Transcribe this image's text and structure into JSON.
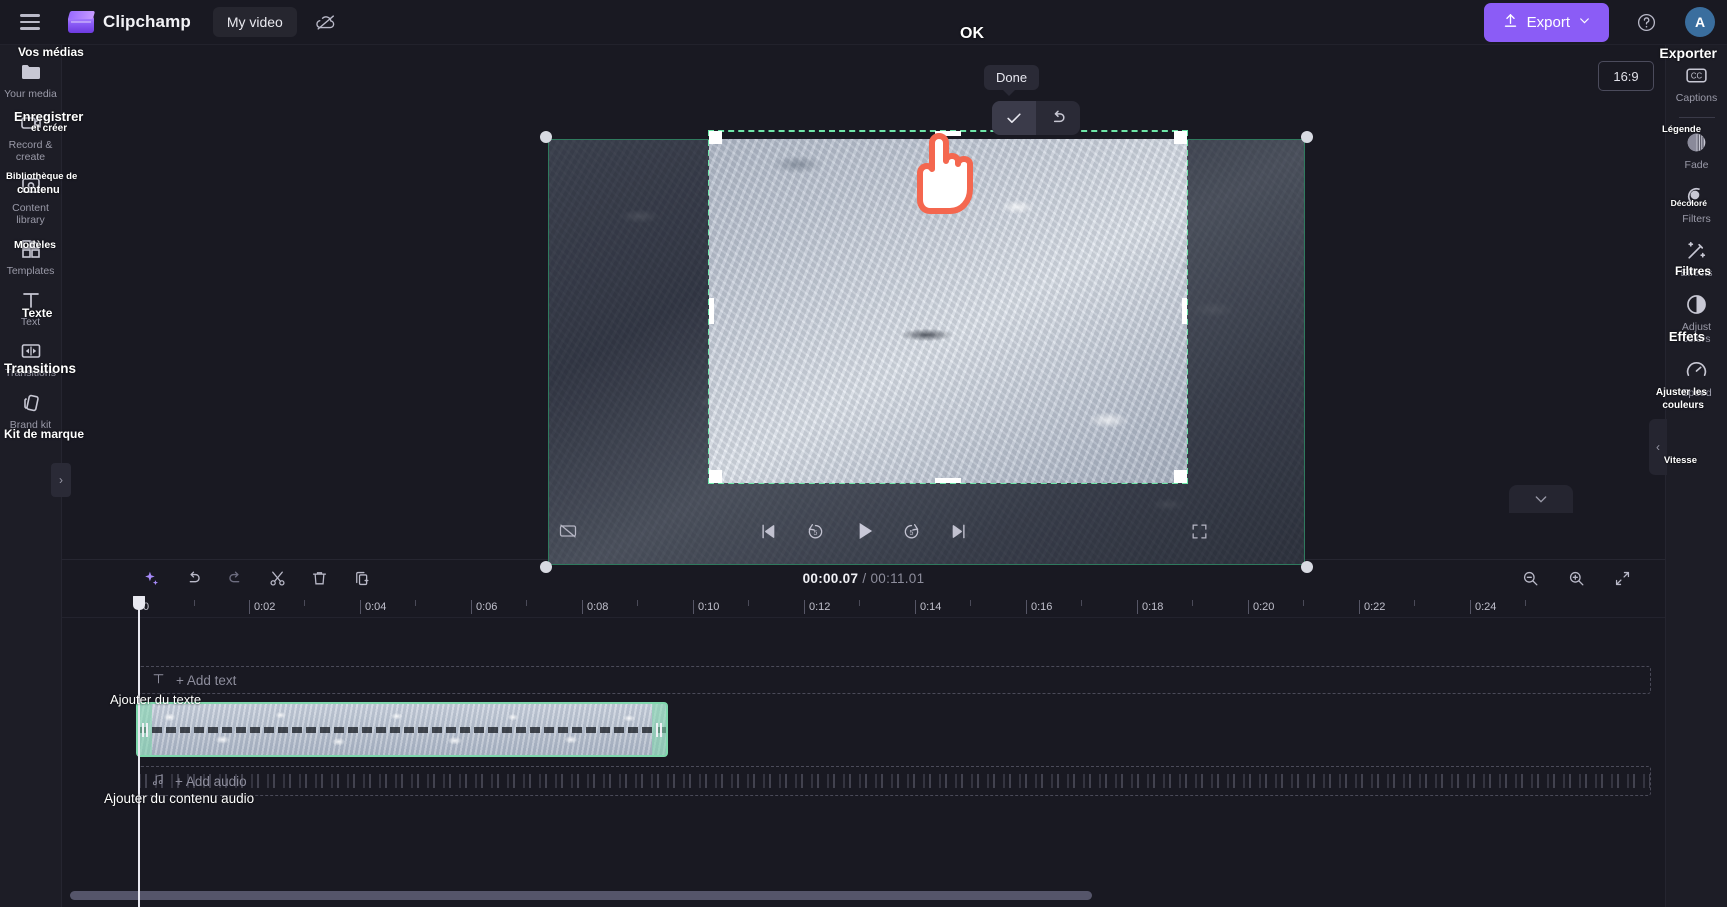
{
  "app": {
    "brand": "Clipchamp",
    "project_name": "My video",
    "avatar_initial": "A"
  },
  "topbar": {
    "menu_icon": "hamburger-icon",
    "logo_icon": "clipchamp-logo-icon",
    "cloud_off_icon": "cloud-off-icon",
    "export_label": "Export",
    "export_icon": "upload-icon",
    "export_chevron": "chevron-down-icon",
    "help_icon": "question-circle-icon",
    "export_color": "#8b5cf6"
  },
  "crop_toolbar": {
    "tooltip": "Done",
    "confirm_icon": "checkmark-icon",
    "reset_icon": "undo-arrow-icon"
  },
  "left_rail": {
    "items": [
      {
        "label": "Your media",
        "icon": "folder-icon",
        "fr": "Vos médias"
      },
      {
        "label": "Record & create",
        "icon": "record-icon",
        "fr": "Enregistrer et créer"
      },
      {
        "label": "Content library",
        "icon": "library-icon",
        "fr": "Bibliothèque de contenu"
      },
      {
        "label": "Templates",
        "icon": "templates-icon",
        "fr": "Modèles"
      },
      {
        "label": "Text",
        "icon": "text-t-icon",
        "fr": "Texte"
      },
      {
        "label": "Transitions",
        "icon": "transitions-icon",
        "fr": "Transitions"
      },
      {
        "label": "Brand kit",
        "icon": "brand-kit-icon",
        "fr": "Kit de marque"
      }
    ],
    "collapse_icon": "chevron-right-icon"
  },
  "right_rail": {
    "aspect_ratio": "16:9",
    "items": [
      {
        "label": "Captions",
        "icon": "cc-icon",
        "fr": ""
      },
      {
        "label": "Fade",
        "icon": "fade-circle-icon",
        "fr": "Légende"
      },
      {
        "label": "Filters",
        "icon": "filters-icon",
        "fr": "Décoloré"
      },
      {
        "label": "Effects",
        "icon": "effects-wand-icon",
        "fr": "Filtres"
      },
      {
        "label": "Adjust colors",
        "icon": "adjust-colors-icon",
        "fr": "Effets"
      },
      {
        "label": "Speed",
        "icon": "speed-icon",
        "fr": "Ajuster les couleurs"
      }
    ],
    "extra_fr": "Vitesse",
    "collapse_icon": "chevron-left-icon"
  },
  "overlay_fr": {
    "exporter": "Exporter",
    "ok": "OK",
    "add_text": "Ajouter du texte",
    "add_audio_content": "Ajouter du contenu audio"
  },
  "player": {
    "hand_cursor_icon": "pointing-hand-cursor",
    "selection_color": "#2f7a5e",
    "crop_border_color": "#6ee7a8"
  },
  "playback": {
    "mute_icon": "no-captions-icon",
    "skip_back_icon": "skip-previous-icon",
    "rewind_icon": "rewind-5-icon",
    "play_icon": "play-icon",
    "forward_icon": "forward-5-icon",
    "skip_forward_icon": "skip-next-icon",
    "fullscreen_icon": "fullscreen-icon",
    "collapse_icon": "chevron-down-icon"
  },
  "timeline": {
    "tools": [
      {
        "icon": "ai-sparkle-icon",
        "name": "magic-tools"
      },
      {
        "icon": "undo-icon",
        "name": "undo"
      },
      {
        "icon": "redo-icon",
        "name": "redo"
      },
      {
        "icon": "scissors-icon",
        "name": "split"
      },
      {
        "icon": "trash-icon",
        "name": "delete"
      },
      {
        "icon": "duplicate-icon",
        "name": "duplicate"
      }
    ],
    "current_time": "00:00.07",
    "total_time": "00:11.01",
    "time_separator": "/",
    "zoom_out_icon": "zoom-out-icon",
    "zoom_in_icon": "zoom-in-icon",
    "fit_icon": "fit-to-screen-icon",
    "ruler_labels": [
      "0",
      "0:02",
      "0:04",
      "0:06",
      "0:08",
      "0:10",
      "0:12",
      "0:14",
      "0:16",
      "0:18",
      "0:20",
      "0:22",
      "0:24"
    ],
    "text_track_placeholder": "+ Add text",
    "text_track_icon": "text-t-icon",
    "audio_track_placeholder": "+ Add audio",
    "audio_track_icon": "music-note-icon",
    "video_clip_label": "",
    "clip_border_color": "#7fd8ad"
  }
}
